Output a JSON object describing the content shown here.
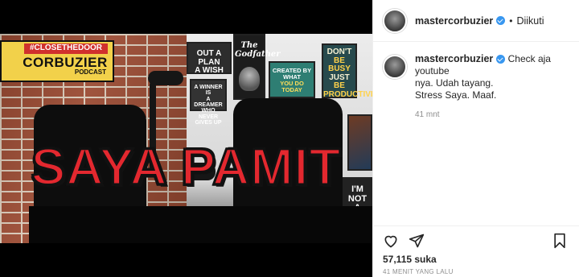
{
  "media": {
    "headline": "SAYA PAMIT",
    "logo": {
      "hashtag": "#CLOSETHEDOOR",
      "brand": "CORBUZIER",
      "subtitle": "PODCAST"
    },
    "signs": {
      "plan": [
        "OUT A PLAN",
        "A WISH"
      ],
      "godfather": "The Godfather",
      "winner": [
        "A WINNER IS",
        "A DREAMER",
        "WHO NEVER",
        "GIVES UP"
      ],
      "created": [
        "CREATED BY WHAT",
        "YOU DO TODAY"
      ],
      "busy": [
        "DON'T",
        "BE BUSY",
        "JUST",
        "BE",
        "PRODUCTIVE"
      ],
      "im": [
        "I'M",
        "NOT A"
      ]
    }
  },
  "header": {
    "username": "mastercorbuzier",
    "separator": "•",
    "follow_label": "Diikuti"
  },
  "caption": {
    "username": "mastercorbuzier",
    "text_line1": "Check aja youtube",
    "text_line2": "nya. Udah tayang.",
    "text_line3": "Stress Saya. Maaf.",
    "time": "41 mnt"
  },
  "actions": {
    "icons": [
      "heart-icon",
      "share-icon",
      "bookmark-icon"
    ]
  },
  "likes": "57,115 suka",
  "posted_ago": "41 MENIT YANG LALU",
  "colors": {
    "verified": "#3897f0",
    "headline": "#e3282f",
    "muted": "#8e8e8e"
  }
}
